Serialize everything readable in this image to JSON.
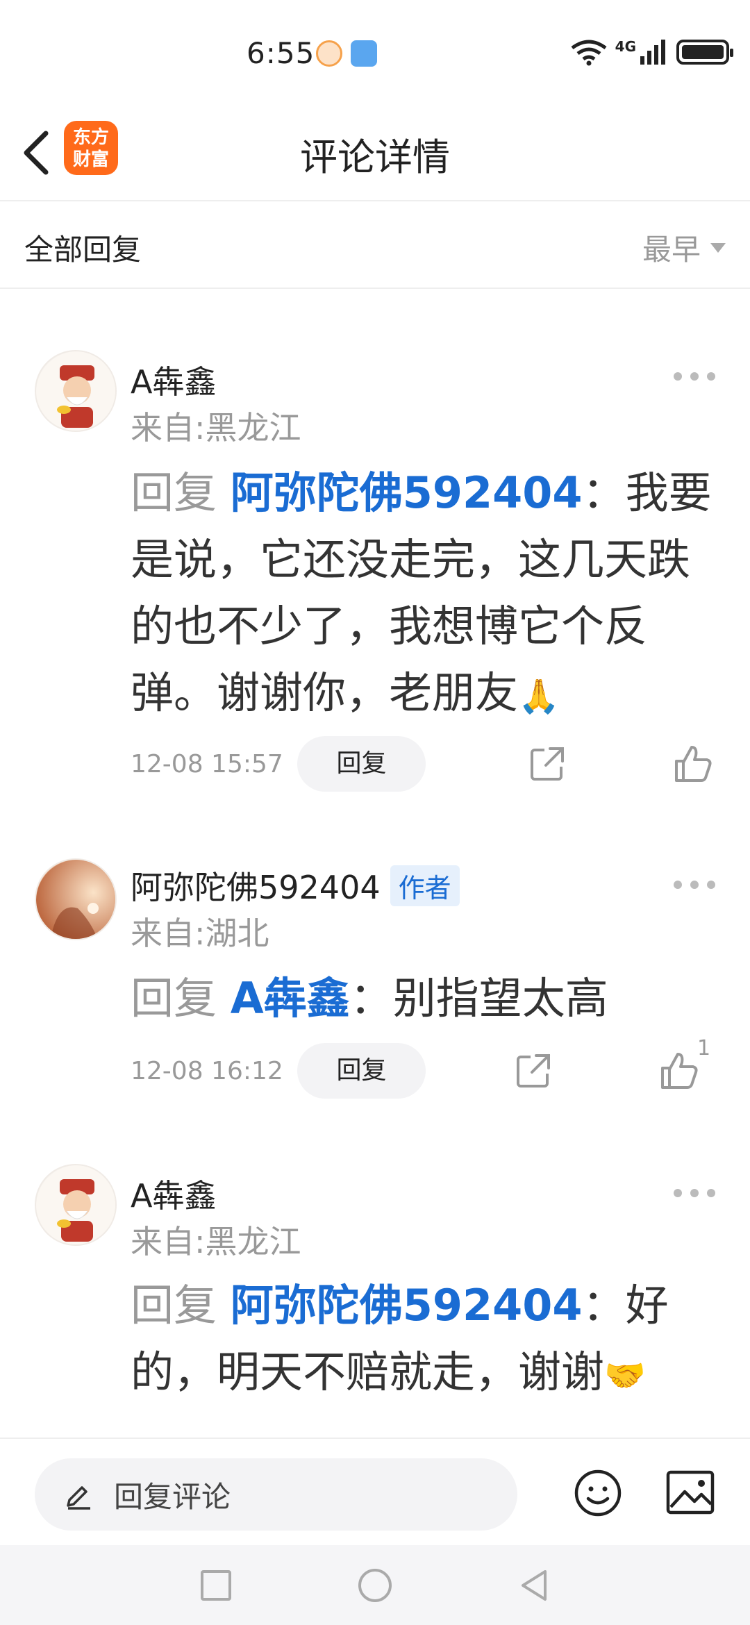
{
  "status_bar": {
    "time": "6:55",
    "network": "4G",
    "wifi_badge": "6"
  },
  "header": {
    "title": "评论详情",
    "logo_line1": "东方",
    "logo_line2": "财富",
    "logo_color": "#ff6a1a"
  },
  "filter": {
    "label": "全部回复",
    "sort": "最早"
  },
  "comments": [
    {
      "username": "A犇鑫",
      "author_badge": "",
      "location": "来自:黑龙江",
      "reply_word": "回复",
      "mention": "阿弥陀佛592404",
      "colon": "：",
      "text": "我要是说，它还没走完，这几天跌的也不少了，我想博它个反弹。谢谢你，老朋友",
      "emoji": "🙏",
      "time": "12-08 15:57",
      "reply_label": "回复",
      "likes": ""
    },
    {
      "username": "阿弥陀佛592404",
      "author_badge": "作者",
      "location": "来自:湖北",
      "reply_word": "回复",
      "mention": "A犇鑫",
      "colon": "：",
      "text": "别指望太高",
      "emoji": "",
      "time": "12-08 16:12",
      "reply_label": "回复",
      "likes": "1"
    },
    {
      "username": "A犇鑫",
      "author_badge": "",
      "location": "来自:黑龙江",
      "reply_word": "回复",
      "mention": "阿弥陀佛592404",
      "colon": "：",
      "text": "好的，明天不赔就走，谢谢",
      "emoji": "🤝",
      "time": "",
      "reply_label": "",
      "likes": ""
    }
  ],
  "bottom_bar": {
    "placeholder": "回复评论"
  },
  "colors": {
    "accent": "#1a6cd3",
    "muted": "#999999"
  }
}
